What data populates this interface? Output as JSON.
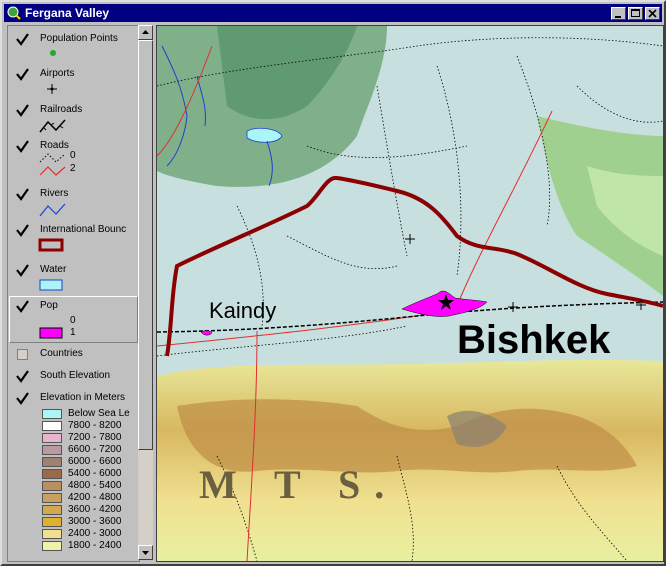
{
  "window": {
    "title": "Fergana Valley"
  },
  "toc": {
    "layers": [
      {
        "name": "Population Points",
        "checked": true
      },
      {
        "name": "Airports",
        "checked": true
      },
      {
        "name": "Railroads",
        "checked": true
      },
      {
        "name": "Roads",
        "checked": true,
        "legend": [
          "0",
          "2"
        ]
      },
      {
        "name": "Rivers",
        "checked": true
      },
      {
        "name": "International Bounc",
        "checked": true
      },
      {
        "name": "Water",
        "checked": true
      },
      {
        "name": "Pop",
        "checked": true,
        "legend": [
          "0",
          "1"
        ]
      },
      {
        "name": "Countries",
        "checked": false
      },
      {
        "name": "South Elevation",
        "checked": true
      },
      {
        "name": "Elevation in Meters",
        "checked": true
      }
    ],
    "elevation_legend": [
      {
        "label": "Below Sea Le",
        "color": "#aaf5f5"
      },
      {
        "label": "7800 - 8200",
        "color": "#ffffff"
      },
      {
        "label": "7200 - 7800",
        "color": "#e6b4cc"
      },
      {
        "label": "6600 - 7200",
        "color": "#b89aa0"
      },
      {
        "label": "6000 - 6600",
        "color": "#a08070"
      },
      {
        "label": "5400 - 6000",
        "color": "#9a6a4a"
      },
      {
        "label": "4800 - 5400",
        "color": "#b89060"
      },
      {
        "label": "4200 - 4800",
        "color": "#c8a060"
      },
      {
        "label": "3600 - 4200",
        "color": "#d4a850"
      },
      {
        "label": "3000 - 3600",
        "color": "#e0b030"
      },
      {
        "label": "2400 - 3000",
        "color": "#f0e090"
      },
      {
        "label": "1800 - 2400",
        "color": "#f0f0a8"
      }
    ]
  },
  "map": {
    "labels": {
      "kaindy": "Kaindy",
      "bishkek": "Bishkek",
      "mts": "M T S."
    },
    "colors": {
      "valley": "#c8dfe0",
      "green": "#6fa86f",
      "boundary": "#8b0000",
      "city": "#ff00ff",
      "road": "#e03030",
      "river": "#1e40d0"
    }
  }
}
